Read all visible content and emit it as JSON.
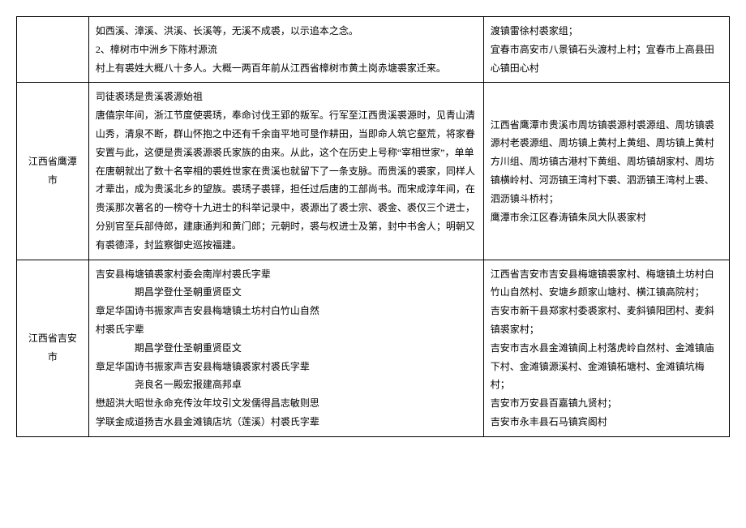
{
  "rows": [
    {
      "region": "",
      "desc": "如西溪、漳溪、洪溪、长溪等，无溪不成裘，以示追本之念。\n2、樟树市中洲乡下陈村源流\n村上有裘姓大概八十多人。大概一两百年前从江西省樟树市黄土岗赤塘裘家迁来。",
      "places": "渡镇雷徐村裘家组；\n宜春市高安市八景镇石头渡村上村；宜春市上高县田心镇田心村"
    },
    {
      "region": "江西省鹰潭市",
      "desc": "司徒裘琇是贵溪裘源始祖\n唐僖宗年间，浙江节度使裘琇，奉命讨伐王郢的叛军。行军至江西贵溪裘源时，见青山清山秀，清泉不断，群山怀抱之中还有千余亩平地可垦作耕田，当即命人筑它壑荒，将家眷安置与此，这便是贵溪裘源裘氏家族的由来。从此，这个在历史上号称“宰相世家”，单单在唐朝就出了数十名宰相的裘姓世家在贵溪也就留下了一条支脉。而贵溪的裘家，同样人才辈出，成为贵溪北乡的望族。裘琇子裘铎，担任过后唐的工部尚书。而宋成淳年间，在贵溪那次著名的一榜夺十九进士的科举记录中，裘源出了裘士宗、裘金、裘仅三个进士，分别官至兵部侍郎，建康通判和黄门郎；元朝时，裘与权进士及第，封中书舍人；明朝又有裘德泽，封监察御史巡按福建。",
      "places": "江西省鹰潭市贵溪市周坊镇裘源村裘源组、周坊镇裘源村老裘源组、周坊镇上黄村上黄组、周坊镇上黄村方川组、周坊镇古港村下黄组、周坊镇胡家村、周坊镇横岭村、河沥镇王湾村下裘、泗沥镇王湾村上裘、泗沥镇斗桥村；\n鹰潭市余江区春涛镇朱凤大队裘家村"
    },
    {
      "region": "江西省吉安市",
      "desc": "吉安县梅塘镇裘家村委会南岸村裘氏字辈\n　　　　期昌学登仕圣朝重贤臣文\n章足华国诗书振家声吉安县梅塘镇土坊村白竹山自然\n村裘氏字辈\n　　　　期昌学登仕圣朝重贤臣文\n章足华国诗书振家声吉安县梅塘镇裘家村裘氏字辈\n　　　　尧良名一殿宏报建高邦卓\n懋超洪大昭世永命充传汝年坟引文发儒得昌志敏则思\n学联金成道扬吉水县金滩镇店坑（莲溪）村裘氏字辈",
      "places": "江西省吉安市吉安县梅塘镇裘家村、梅塘镇土坊村白竹山自然村、安塘乡颜家山塘村、横江镇高院村；\n吉安市新干县郑家村委裘家村、麦斜镇阳团村、麦斜镇裘家村；\n吉安市吉水县金滩镇阆上村落虎岭自然村、金滩镇庙下村、金滩镇源溪村、金滩镇柘塘村、金滩镇坑梅村；\n吉安市万安县百嘉镇九贤村；\n吉安市永丰县石马镇宾阁村"
    }
  ]
}
